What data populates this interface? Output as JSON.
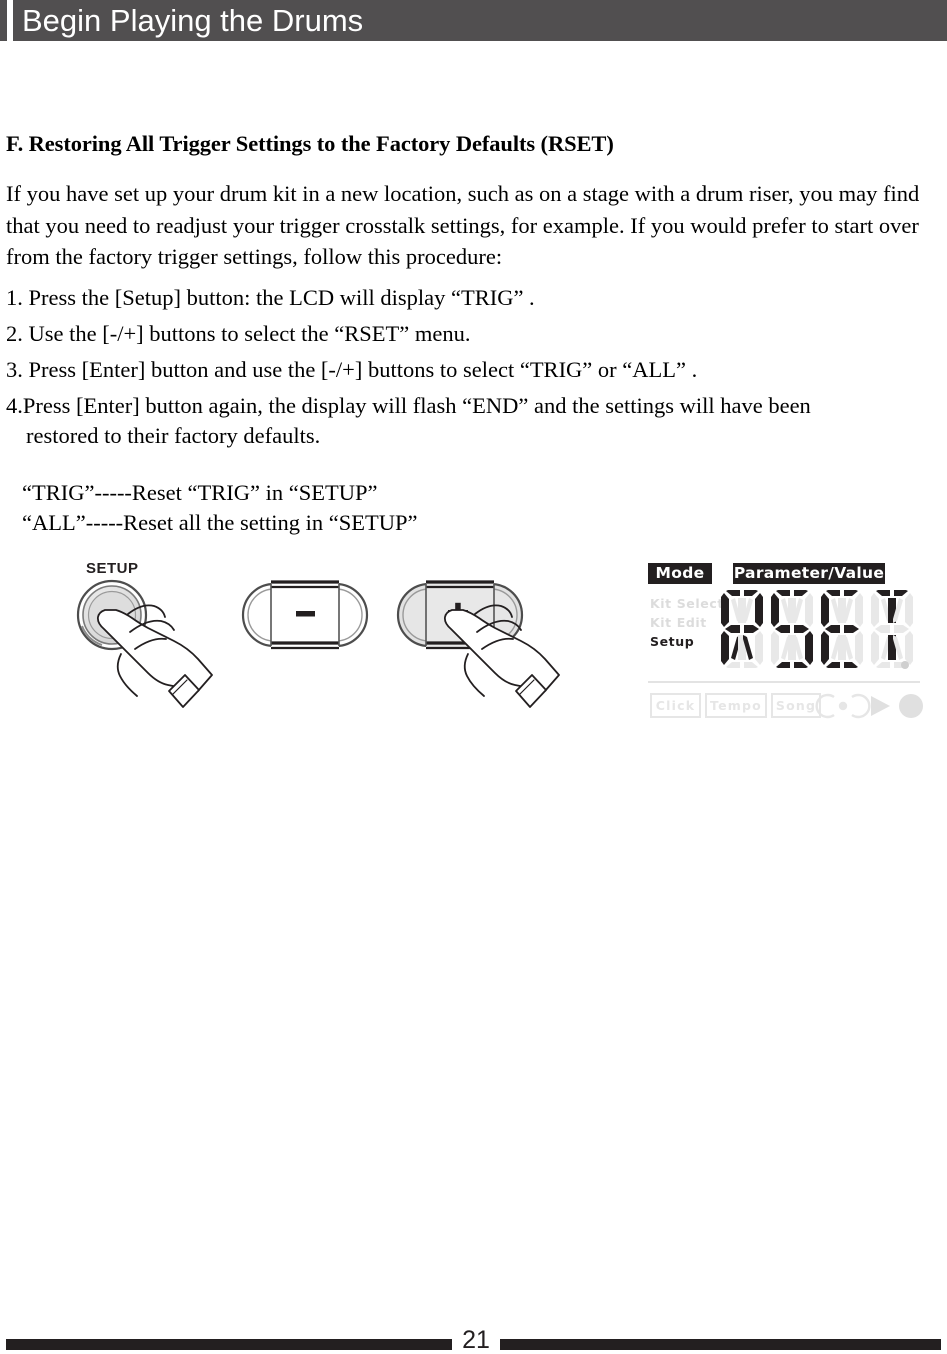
{
  "header": {
    "title": "Begin Playing the Drums"
  },
  "section": {
    "heading": "F. Restoring All Trigger Settings to the Factory Defaults (RSET)",
    "intro": "If you have set up your drum kit in a new location, such as on a stage with a drum riser, you may find that you need to readjust your trigger crosstalk settings, for example. If you would prefer to start over from the factory trigger settings, follow this procedure:",
    "steps": [
      "1. Press the [Setup] button: the LCD will  display “TRIG” .",
      "2. Use the [-/+] buttons to select the “RSET”  menu.",
      "3. Press [Enter] button and use the [-/+] buttons to select “TRIG” or “ALL” .",
      "4.Press [Enter] button again, the display will flash “END”  and the settings will have been",
      "restored to their factory defaults."
    ],
    "reset_lines": [
      "“TRIG”-----Reset “TRIG”  in “SETUP”",
      "“ALL”-----Reset all the setting  in “SETUP”"
    ]
  },
  "diagram": {
    "setup_button_label": "SETUP",
    "minus_button_label": "–",
    "plus_button_label": "+"
  },
  "lcd": {
    "tag_mode": "Mode",
    "tag_parameter": "Parameter/Value",
    "modes": [
      {
        "label": "Kit Select",
        "active": false
      },
      {
        "label": "Kit Edit",
        "active": false
      },
      {
        "label": "Setup",
        "active": true
      }
    ],
    "display_value": "RSET",
    "segments": [
      {
        "char": "R",
        "on": [
          "a1",
          "a2",
          "f",
          "b",
          "g1",
          "g2",
          "e",
          "k",
          "m"
        ]
      },
      {
        "char": "S",
        "on": [
          "a1",
          "a2",
          "f",
          "g1",
          "g2",
          "c",
          "d1",
          "d2"
        ]
      },
      {
        "char": "E",
        "on": [
          "a1",
          "a2",
          "f",
          "e",
          "g1",
          "g2",
          "d1",
          "d2"
        ]
      },
      {
        "char": "T",
        "on": [
          "a1",
          "a2",
          "i",
          "l"
        ]
      }
    ],
    "bottom_buttons": [
      {
        "label": "Click",
        "active": false
      },
      {
        "label": "Tempo",
        "active": false
      },
      {
        "label": "Song",
        "active": false
      }
    ],
    "transport_icons": [
      "record-icon",
      "play-icon",
      "circle-icon"
    ],
    "colors": {
      "segment_on": "#231f20",
      "segment_off": "#e8e8e8",
      "tag_bg": "#231f20",
      "inactive_text": "#dcdcdc"
    }
  },
  "footer": {
    "page_number": "21"
  }
}
